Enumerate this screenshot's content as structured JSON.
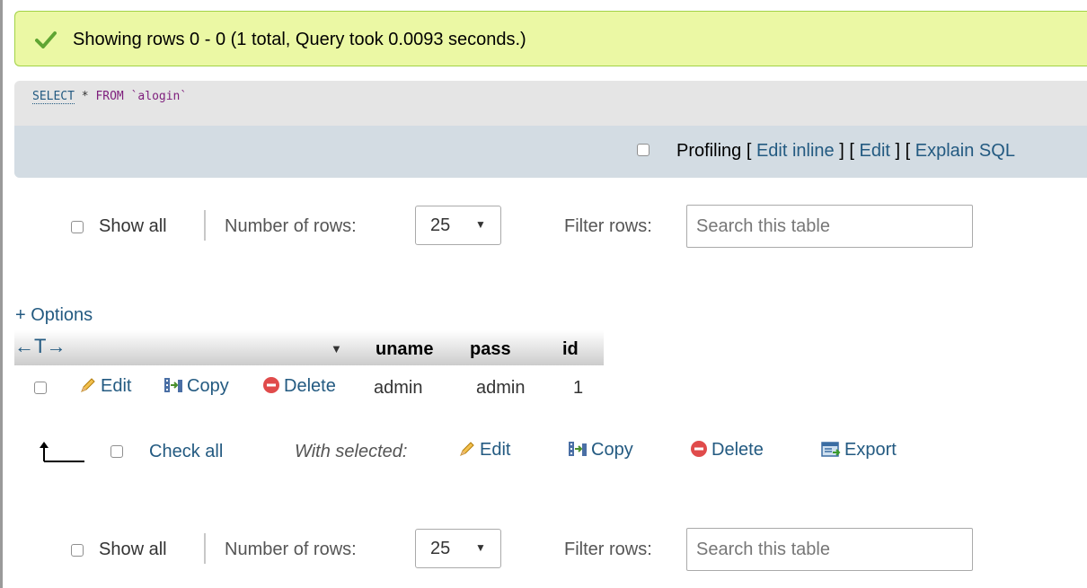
{
  "message": {
    "text": "Showing rows 0 - 0 (1 total, Query took 0.0093 seconds.)",
    "colors": {
      "bg": "#ebf8a4",
      "border": "#a2d246",
      "icon": "#5fa532"
    }
  },
  "sql": {
    "select": "SELECT",
    "star": "*",
    "from": "FROM",
    "table": "`alogin`"
  },
  "sql_tools": {
    "profiling": "Profiling",
    "bracket_open": "[",
    "bracket_close": "]",
    "edit_inline": "Edit inline",
    "edit": "Edit",
    "explain": "Explain SQL"
  },
  "nav_top": {
    "show_all": "Show all",
    "rows_label": "Number of rows:",
    "rows_value": "25",
    "filter_label": "Filter rows:",
    "search_placeholder": "Search this table"
  },
  "nav_bottom": {
    "show_all": "Show all",
    "rows_label": "Number of rows:",
    "rows_value": "25",
    "filter_label": "Filter rows:",
    "search_placeholder": "Search this table"
  },
  "options_label": "+ Options",
  "table": {
    "arrows": "←T→",
    "columns": [
      "uname",
      "pass",
      "id"
    ],
    "row": {
      "edit": "Edit",
      "copy": "Copy",
      "delete": "Delete",
      "values": [
        "admin",
        "admin",
        "1"
      ]
    }
  },
  "bulk": {
    "check_all": "Check all",
    "with_selected": "With selected:",
    "edit": "Edit",
    "copy": "Copy",
    "delete": "Delete",
    "export": "Export"
  },
  "icons": {
    "check": "check-icon",
    "pencil": "pencil-icon",
    "copy": "copy-icon",
    "delete": "delete-icon",
    "export": "export-icon"
  },
  "colors": {
    "link": "#235a81",
    "toolbar": "#d3dce3",
    "sqlbox": "#e5e5e5"
  }
}
